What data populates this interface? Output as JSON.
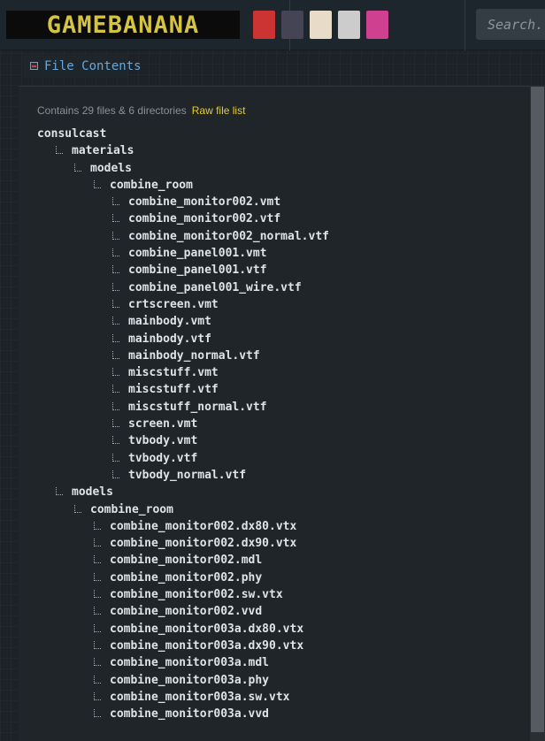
{
  "header": {
    "logo": "GAMEBANANA",
    "search_placeholder": "Search...",
    "avatars": [
      {
        "name": "fnf-avatar",
        "color": "#c33"
      },
      {
        "name": "dark-hair-avatar",
        "color": "#445"
      },
      {
        "name": "blonde-avatar",
        "color": "#e8dcc8"
      },
      {
        "name": "white-hair-avatar",
        "color": "#ccc"
      },
      {
        "name": "infinity-logo-avatar",
        "color": "#d04090"
      }
    ]
  },
  "section": {
    "title": "File Contents"
  },
  "summary": {
    "text": "Contains 29 files & 6 directories",
    "raw_link": "Raw file list"
  },
  "tree": [
    {
      "name": "consulcast",
      "depth": 0
    },
    {
      "name": "materials",
      "depth": 1
    },
    {
      "name": "models",
      "depth": 2
    },
    {
      "name": "combine_room",
      "depth": 3
    },
    {
      "name": "combine_monitor002.vmt",
      "depth": 4
    },
    {
      "name": "combine_monitor002.vtf",
      "depth": 4
    },
    {
      "name": "combine_monitor002_normal.vtf",
      "depth": 4
    },
    {
      "name": "combine_panel001.vmt",
      "depth": 4
    },
    {
      "name": "combine_panel001.vtf",
      "depth": 4
    },
    {
      "name": "combine_panel001_wire.vtf",
      "depth": 4
    },
    {
      "name": "crtscreen.vmt",
      "depth": 4
    },
    {
      "name": "mainbody.vmt",
      "depth": 4
    },
    {
      "name": "mainbody.vtf",
      "depth": 4
    },
    {
      "name": "mainbody_normal.vtf",
      "depth": 4
    },
    {
      "name": "miscstuff.vmt",
      "depth": 4
    },
    {
      "name": "miscstuff.vtf",
      "depth": 4
    },
    {
      "name": "miscstuff_normal.vtf",
      "depth": 4
    },
    {
      "name": "screen.vmt",
      "depth": 4
    },
    {
      "name": "tvbody.vmt",
      "depth": 4
    },
    {
      "name": "tvbody.vtf",
      "depth": 4
    },
    {
      "name": "tvbody_normal.vtf",
      "depth": 4
    },
    {
      "name": "models",
      "depth": 1
    },
    {
      "name": "combine_room",
      "depth": 2
    },
    {
      "name": "combine_monitor002.dx80.vtx",
      "depth": 3
    },
    {
      "name": "combine_monitor002.dx90.vtx",
      "depth": 3
    },
    {
      "name": "combine_monitor002.mdl",
      "depth": 3
    },
    {
      "name": "combine_monitor002.phy",
      "depth": 3
    },
    {
      "name": "combine_monitor002.sw.vtx",
      "depth": 3
    },
    {
      "name": "combine_monitor002.vvd",
      "depth": 3
    },
    {
      "name": "combine_monitor003a.dx80.vtx",
      "depth": 3
    },
    {
      "name": "combine_monitor003a.dx90.vtx",
      "depth": 3
    },
    {
      "name": "combine_monitor003a.mdl",
      "depth": 3
    },
    {
      "name": "combine_monitor003a.phy",
      "depth": 3
    },
    {
      "name": "combine_monitor003a.sw.vtx",
      "depth": 3
    },
    {
      "name": "combine_monitor003a.vvd",
      "depth": 3
    }
  ]
}
